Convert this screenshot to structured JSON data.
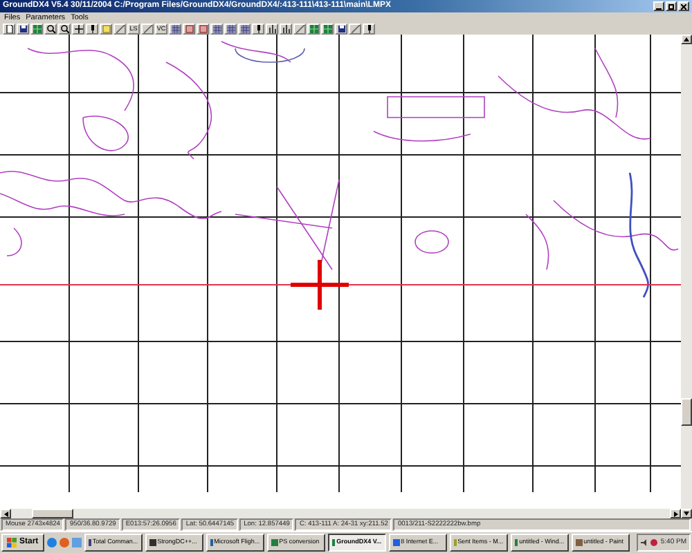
{
  "window": {
    "title": "GroundDX4 V5.4 30/11/2004  C:/Program Files/GroundDX4/GroundDX4/:413-111\\413-111\\main\\LMPX"
  },
  "menu": [
    {
      "label": "Files"
    },
    {
      "label": "Parameters"
    },
    {
      "label": "Tools"
    }
  ],
  "toolbar": [
    {
      "kind": "new"
    },
    {
      "kind": "save"
    },
    {
      "kind": "map"
    },
    {
      "kind": "zoom"
    },
    {
      "kind": "zoom"
    },
    {
      "kind": "plus"
    },
    {
      "kind": "pin"
    },
    {
      "kind": "note"
    },
    {
      "kind": "line"
    },
    {
      "kind": "text",
      "label": "LS"
    },
    {
      "kind": "line"
    },
    {
      "kind": "text",
      "label": "VC"
    },
    {
      "kind": "grid"
    },
    {
      "kind": "frame"
    },
    {
      "kind": "frame"
    },
    {
      "kind": "grid"
    },
    {
      "kind": "grid"
    },
    {
      "kind": "grid"
    },
    {
      "kind": "pin"
    },
    {
      "kind": "bars"
    },
    {
      "kind": "bars"
    },
    {
      "kind": "line"
    },
    {
      "kind": "map"
    },
    {
      "kind": "map"
    },
    {
      "kind": "save"
    },
    {
      "kind": "line"
    },
    {
      "kind": "pin"
    }
  ],
  "status_bar": [
    "Mouse 2743x4824",
    "950/36.80.9729",
    "E013:57:26.0956",
    "Lat: 50.6447145",
    "Lon: 12.857449",
    "C: 413-111  A: 24-31  xy:211.52",
    "0013/211-S2222222bw.bmp"
  ],
  "taskbar": {
    "start": "Start",
    "tasks": [
      {
        "label": "Total Comman...",
        "selected": false
      },
      {
        "label": "StrongDC++...",
        "selected": false
      },
      {
        "label": "Microsoft Fligh...",
        "selected": false
      },
      {
        "label": "PS conversion",
        "selected": false
      },
      {
        "label": "GroundDX4 V...",
        "selected": true
      },
      {
        "label": "8 Internet E...",
        "selected": false
      },
      {
        "label": "Sent Items - M...",
        "selected": false
      },
      {
        "label": "untitled - Wind...",
        "selected": false
      },
      {
        "label": "untitled - Paint",
        "selected": false
      }
    ],
    "clock": "5:40 PM"
  }
}
